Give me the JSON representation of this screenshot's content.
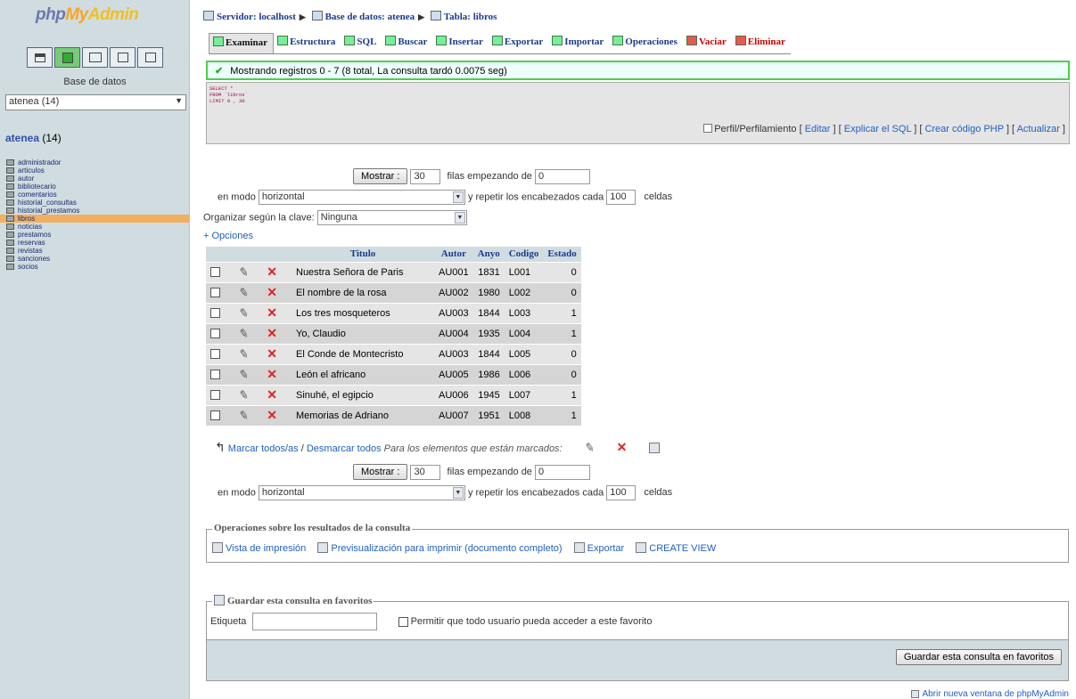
{
  "sidebar": {
    "logo": {
      "part1": "php",
      "part2": "My",
      "part3": "Admin"
    },
    "quick_icons": [
      "home-icon",
      "sql-query-icon",
      "docs-icon",
      "sql-window-icon",
      "reload-icon"
    ],
    "db_label": "Base de datos",
    "db_select_value": "atenea (14)",
    "db_heading_name": "atenea",
    "db_heading_count": "(14)",
    "tables": [
      "administrador",
      "articulos",
      "autor",
      "bibliotecario",
      "comentarios",
      "historial_consultas",
      "historial_prestamos",
      "libros",
      "noticias",
      "prestamos",
      "reservas",
      "revistas",
      "sanciones",
      "socios"
    ],
    "active_table": "libros"
  },
  "breadcrumb": {
    "server_label": "Servidor: localhost",
    "db_label": "Base de datos: atenea",
    "table_label": "Tabla: libros"
  },
  "tabs": [
    {
      "label": "Examinar",
      "active": true
    },
    {
      "label": "Estructura"
    },
    {
      "label": "SQL"
    },
    {
      "label": "Buscar"
    },
    {
      "label": "Insertar"
    },
    {
      "label": "Exportar"
    },
    {
      "label": "Importar"
    },
    {
      "label": "Operaciones"
    },
    {
      "label": "Vaciar",
      "danger": true
    },
    {
      "label": "Eliminar",
      "danger": true
    }
  ],
  "message": "Mostrando registros 0 - 7 (8 total, La consulta tardó 0.0075 seg)",
  "sql": {
    "line1": "SELECT *",
    "line2": "FROM `libros`",
    "line3": "LIMIT 0 , 30"
  },
  "sql_links": {
    "profiling": "Perfil/Perfilamiento",
    "edit": "Editar",
    "explain": "Explicar el SQL",
    "php": "Crear código PHP",
    "refresh": "Actualizar"
  },
  "nav": {
    "show_button": "Mostrar :",
    "rows_value": "30",
    "rows_text": "filas empezando de",
    "start_value": "0",
    "mode_label": "en modo",
    "mode_value": "horizontal",
    "repeat_text": "y repetir los encabezados cada",
    "repeat_value": "100",
    "cells_text": "celdas",
    "sort_label": "Organizar según la clave:",
    "sort_value": "Ninguna",
    "options_link": "+ Opciones"
  },
  "table": {
    "headers": [
      "Titulo",
      "Autor",
      "Anyo",
      "Codigo",
      "Estado"
    ],
    "rows": [
      [
        "Nuestra Señora de Paris",
        "AU001",
        "1831",
        "L001",
        "0"
      ],
      [
        "El nombre de la rosa",
        "AU002",
        "1980",
        "L002",
        "0"
      ],
      [
        "Los tres mosqueteros",
        "AU003",
        "1844",
        "L003",
        "1"
      ],
      [
        "Yo, Claudio",
        "AU004",
        "1935",
        "L004",
        "1"
      ],
      [
        "El Conde de Montecristo",
        "AU003",
        "1844",
        "L005",
        "0"
      ],
      [
        "León el africano",
        "AU005",
        "1986",
        "L006",
        "0"
      ],
      [
        "Sinuhé, el egipcio",
        "AU006",
        "1945",
        "L007",
        "1"
      ],
      [
        "Memorias de Adriano",
        "AU007",
        "1951",
        "L008",
        "1"
      ]
    ]
  },
  "mark_row": {
    "mark_all": "Marcar todos/as",
    "sep": " / ",
    "unmark_all": "Desmarcar todos",
    "with_selected": "Para los elementos que están marcados:"
  },
  "query_ops": {
    "legend": "Operaciones sobre los resultados de la consulta",
    "print_view": "Vista de impresión",
    "print_preview": "Previsualización para imprimir (documento completo)",
    "export": "Exportar",
    "create_view": "CREATE VIEW"
  },
  "bookmark": {
    "legend": "Guardar esta consulta en favoritos",
    "label_field": "Etiqueta",
    "label_value": "",
    "allow_all": "Permitir que todo usuario pueda acceder a este favorito",
    "save_button": "Guardar esta consulta en favoritos"
  },
  "footer_link": "Abrir nueva ventana de phpMyAdmin"
}
